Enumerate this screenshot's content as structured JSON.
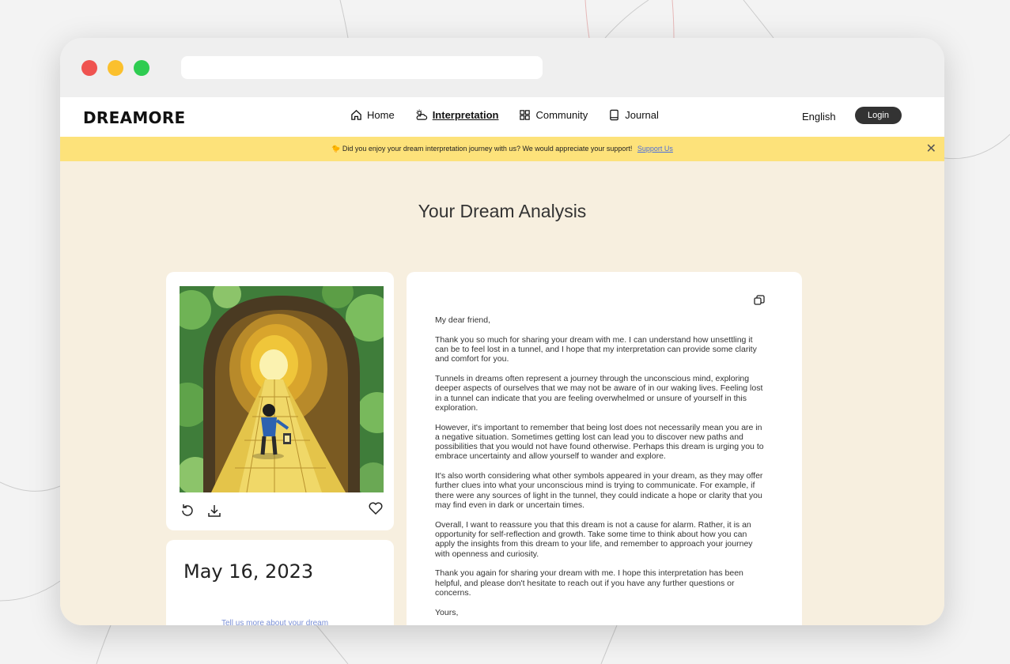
{
  "window": {
    "url": ""
  },
  "navbar": {
    "logo": "DREAMORE",
    "items": [
      {
        "label": "Home",
        "icon": "home-icon",
        "active": false
      },
      {
        "label": "Interpretation",
        "icon": "cloud-icon",
        "active": true
      },
      {
        "label": "Community",
        "icon": "grid-icon",
        "active": false
      },
      {
        "label": "Journal",
        "icon": "book-icon",
        "active": false
      }
    ],
    "language": "English",
    "login": "Login"
  },
  "banner": {
    "emoji": "🐤",
    "text": "Did you enjoy your dream interpretation journey with us? We would appreciate your support!",
    "link": "Support Us",
    "close": "✕"
  },
  "main": {
    "title": "Your Dream Analysis",
    "date": "May 16, 2023",
    "date_hint": "Tell us more about your dream",
    "letter": [
      "My dear friend,",
      "Thank you so much for sharing your dream with me. I can understand how unsettling it can be to feel lost in a tunnel, and I hope that my interpretation can provide some clarity and comfort for you.",
      "Tunnels in dreams often represent a journey through the unconscious mind, exploring deeper aspects of ourselves that we may not be aware of in our waking lives. Feeling lost in a tunnel can indicate that you are feeling overwhelmed or unsure of yourself in this exploration.",
      "However, it's important to remember that being lost does not necessarily mean you are in a negative situation. Sometimes getting lost can lead you to discover new paths and possibilities that you would not have found otherwise. Perhaps this dream is urging you to embrace uncertainty and allow yourself to wander and explore.",
      "It's also worth considering what other symbols appeared in your dream, as they may offer further clues into what your unconscious mind is trying to communicate. For example, if there were any sources of light in the tunnel, they could indicate a hope or clarity that you may find even in dark or uncertain times.",
      "Overall, I want to reassure you that this dream is not a cause for alarm. Rather, it is an opportunity for self-reflection and growth. Take some time to think about how you can apply the insights from this dream to your life, and remember to approach your journey with openness and curiosity.",
      "Thank you again for sharing your dream with me. I hope this interpretation has been helpful, and please don't hesitate to reach out if you have any further questions or concerns.",
      "Yours,"
    ]
  },
  "colors": {
    "banner": "#fde27a",
    "content_bg": "#f7efdf",
    "login_bg": "#333333"
  }
}
